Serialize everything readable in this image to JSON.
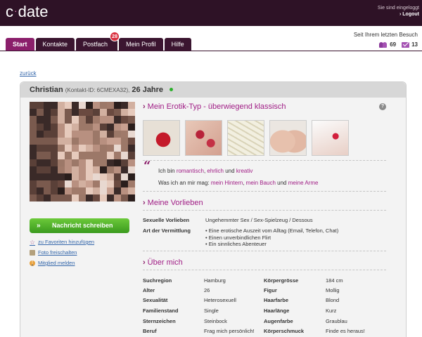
{
  "header": {
    "logo_left": "c",
    "logo_dot": "·",
    "logo_right": "date",
    "login_status": "Sie sind eingeloggt",
    "logout": "› Logout"
  },
  "nav": {
    "tabs": [
      {
        "label": "Start",
        "active": true
      },
      {
        "label": "Kontakte"
      },
      {
        "label": "Postfach",
        "badge": "28"
      },
      {
        "label": "Mein Profil"
      },
      {
        "label": "Hilfe"
      }
    ],
    "last_visit": "Seit Ihrem letzten Besuch",
    "visitors_count": "69",
    "mail_count": "13"
  },
  "back_link": "zurück",
  "profile": {
    "name": "Christian",
    "contact_id": "(Kontakt-ID: 6CMEXA32),",
    "age": "26 Jahre"
  },
  "actions": {
    "message_button": "Nachricht schreiben",
    "message_arrows": "»",
    "favorite": "zu Favoriten hinzufügen",
    "unlock_photo": "Foto freischalten",
    "report": "Mitglied melden"
  },
  "erotik": {
    "title": "Mein Erotik-Typ - überwiegend klassisch",
    "help": "?",
    "quote_mark": "“",
    "line1_prefix": "Ich bin",
    "line1_words": [
      "romantisch",
      "ehrlich",
      "kreativ"
    ],
    "line1_sep": ",",
    "line1_and": "und",
    "line2_prefix": "Was ich an mir mag:",
    "line2_words": [
      "mein Hintern",
      "mein Bauch",
      "meine Arme"
    ],
    "line2_and": "und"
  },
  "vorlieben": {
    "title": "Meine Vorlieben",
    "sexual_label": "Sexuelle Vorlieben",
    "sexual_value": "Ungehemmter Sex / Sex-Spielzeug / Dessous",
    "mediation_label": "Art der Vermittlung",
    "mediation_values": [
      "Eine erotische Auszeit vom Alltag (Email, Telefon, Chat)",
      "Einen unverbindlichen Flirt",
      "Ein sinnliches Abenteuer"
    ]
  },
  "about": {
    "title": "Über mich",
    "left": [
      {
        "label": "Suchregion",
        "value": "Hamburg"
      },
      {
        "label": "Alter",
        "value": "26"
      },
      {
        "label": "Sexualität",
        "value": "Heterosexuell"
      },
      {
        "label": "Familienstand",
        "value": "Single"
      },
      {
        "label": "Sternzeichen",
        "value": "Steinbock"
      },
      {
        "label": "Beruf",
        "value": "Frag mich persönlich!"
      }
    ],
    "right": [
      {
        "label": "Körpergrösse",
        "value": "184 cm"
      },
      {
        "label": "Figur",
        "value": "Mollig"
      },
      {
        "label": "Haarfarbe",
        "value": "Blond"
      },
      {
        "label": "Haarlänge",
        "value": "Kurz"
      },
      {
        "label": "Augenfarbe",
        "value": "Graublau"
      },
      {
        "label": "Körperschmuck",
        "value": "Finde es heraus!"
      }
    ]
  },
  "icons": {
    "visitors": "people-icon",
    "mail": "mail-icon",
    "favorite": "star-icon",
    "photo": "photo-icon",
    "report": "report-icon",
    "section": "chevron-right-icon"
  },
  "colors": {
    "header_bg": "#2e1226",
    "tab_bg": "#3b1530",
    "tab_active": "#8b1f6b",
    "accent": "#a01d85",
    "button_green": "#4aae28",
    "badge_red": "#d9303e"
  }
}
